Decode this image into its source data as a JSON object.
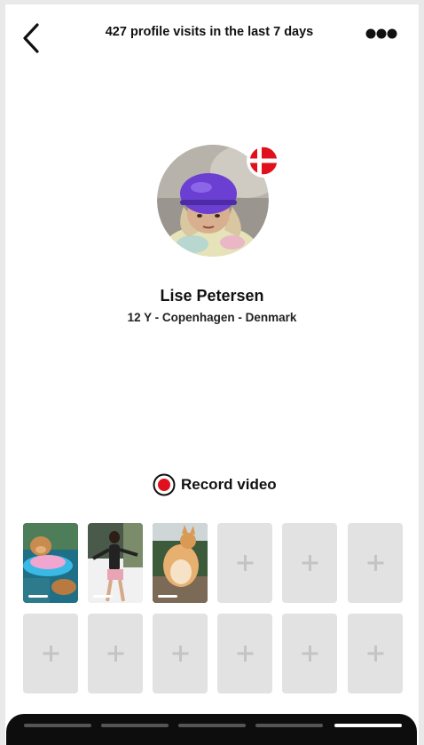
{
  "header": {
    "title": "427 profile visits in the last 7 days",
    "back_icon": "chevron-left-icon",
    "more_icon": "more-dots-icon"
  },
  "profile": {
    "name": "Lise Petersen",
    "details": "12 Y - Copenhagen - Denmark",
    "flag": "denmark-flag-icon"
  },
  "record": {
    "label": "Record video",
    "accent": "#e0101c"
  },
  "videos": [
    {
      "state": "filled",
      "thumb": "dog-in-pool"
    },
    {
      "state": "filled",
      "thumb": "girl-dancing"
    },
    {
      "state": "filled",
      "thumb": "corgi-dog"
    },
    {
      "state": "empty"
    },
    {
      "state": "empty"
    },
    {
      "state": "empty"
    },
    {
      "state": "empty"
    },
    {
      "state": "empty"
    },
    {
      "state": "empty"
    },
    {
      "state": "empty"
    },
    {
      "state": "empty"
    },
    {
      "state": "empty"
    }
  ],
  "bottom_nav": {
    "segments": 5,
    "active_index": 4
  },
  "colors": {
    "empty_tile": "#e2e2e2",
    "plus": "#c4c4c4",
    "bottom_bar": "#0d0d0d"
  }
}
